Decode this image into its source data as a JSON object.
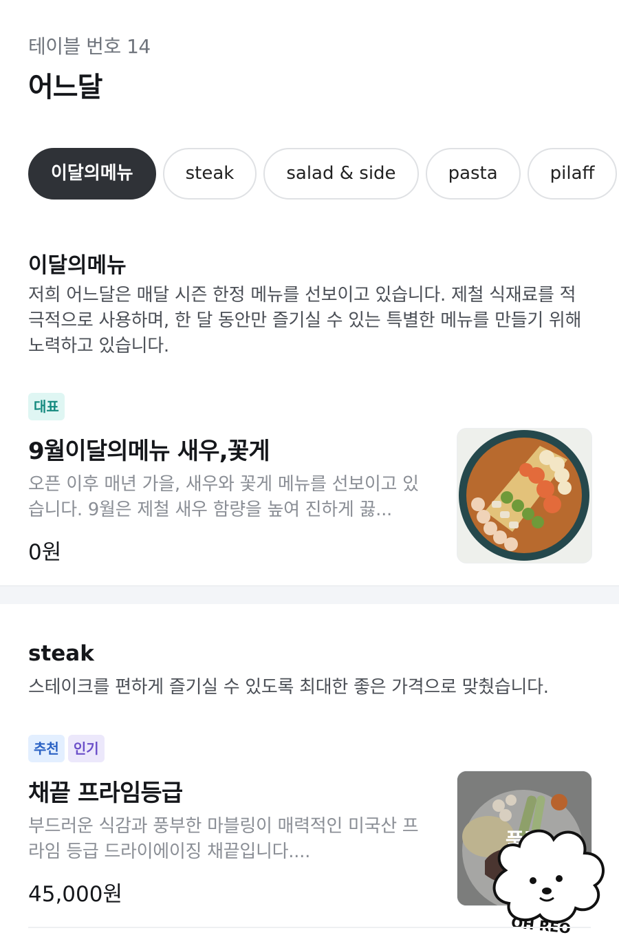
{
  "header": {
    "table_label": "테이블 번호 14",
    "store_name": "어느달"
  },
  "tabs": [
    {
      "label": "이달의메뉴",
      "active": true
    },
    {
      "label": "steak",
      "active": false
    },
    {
      "label": "salad & side",
      "active": false
    },
    {
      "label": "pasta",
      "active": false
    },
    {
      "label": "pilaff",
      "active": false
    }
  ],
  "sections": [
    {
      "title": "이달의메뉴",
      "description": "저희 어느달은 매달 시즌 한정 메뉴를 선보이고 있습니다. 제철 식재료를 적극적으로 사용하며, 한 달 동안만 즐기실 수 있는 특별한 메뉴를 만들기 위해 노력하고 있습니다.",
      "items": [
        {
          "badges": [
            "대표"
          ],
          "name": "9월이달의메뉴 새우,꽃게",
          "description": "오픈 이후 매년 가을, 새우와 꽃게 메뉴를 선보이고 있습니다. 9월은 제철 새우 함량을 높여 진하게 끓...",
          "price": "0원",
          "image": "shrimp-crab-plate"
        }
      ]
    },
    {
      "title": "steak",
      "description": "스테이크를 편하게 즐기실 수 있도록 최대한 좋은 가격으로 맞췄습니다.",
      "items": [
        {
          "badges": [
            "추천",
            "인기"
          ],
          "name": "채끝 프라임등급",
          "description": "부드러운 식감과 풍부한 마블링이 매력적인 미국산 프라임 등급 드라이에이징 채끝입니다....",
          "price": "45,000원",
          "image": "steak-plate",
          "overlay_text": "품절"
        }
      ]
    }
  ],
  "sticker_text": "OH REO",
  "colors": {
    "active_tab": "#2f3237",
    "badge_teal": "#148a7f",
    "badge_blue": "#2b62c4",
    "badge_purple": "#6b4fc9"
  }
}
